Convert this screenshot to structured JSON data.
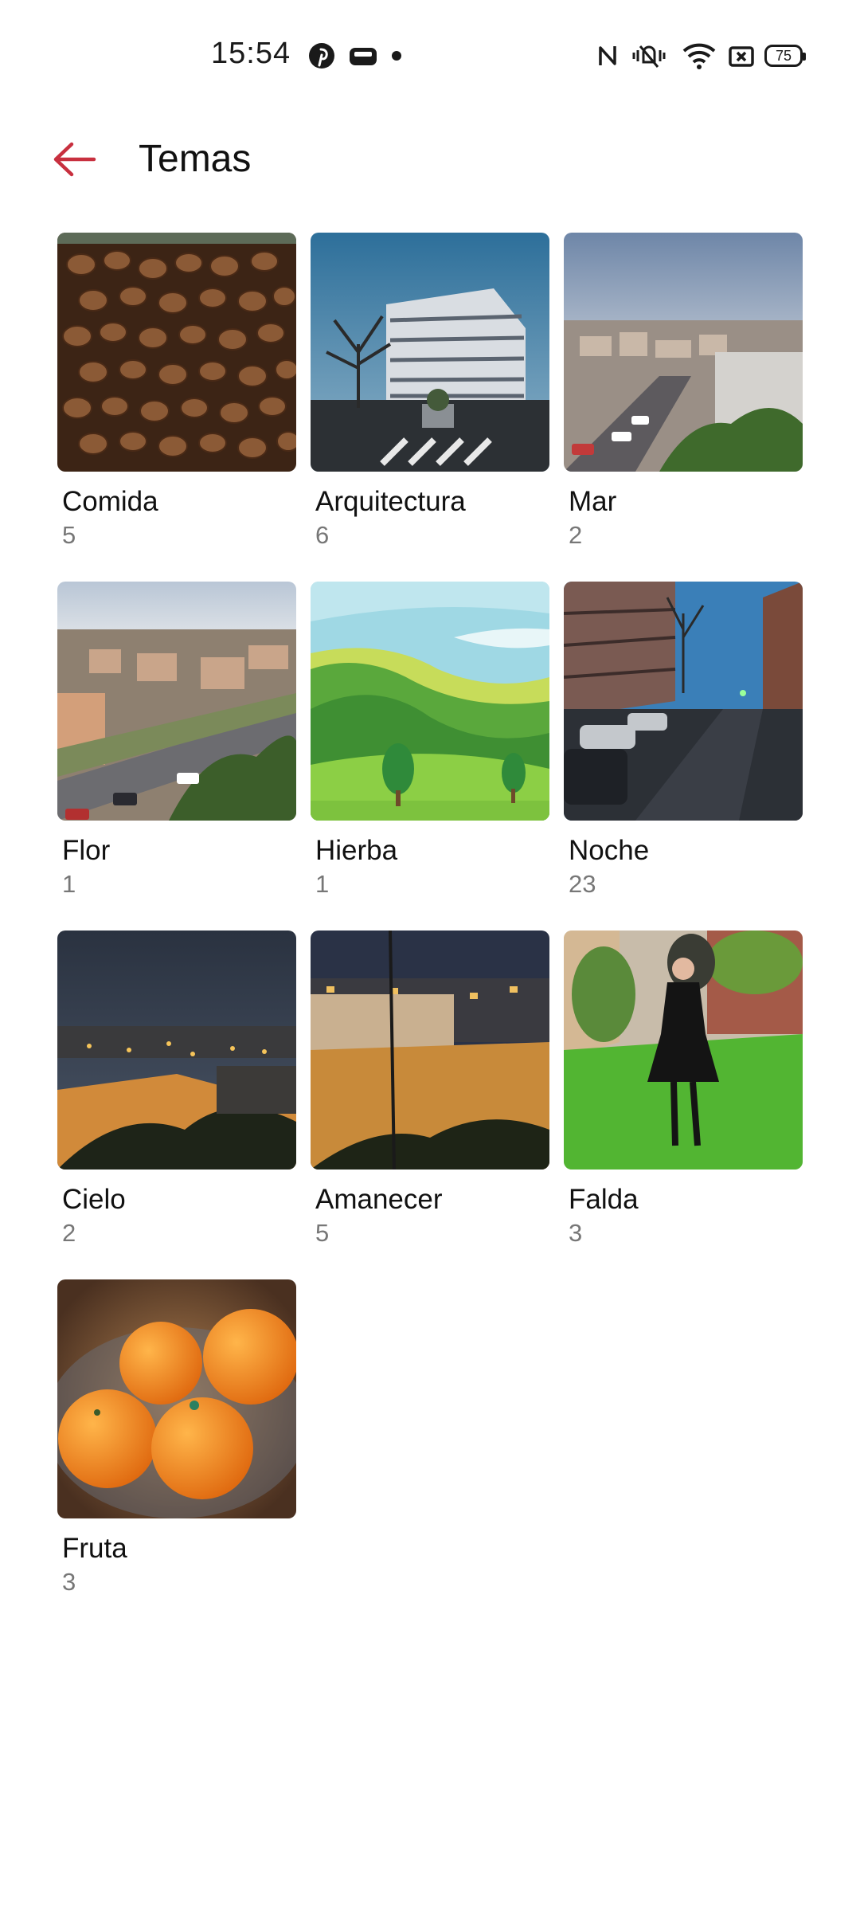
{
  "status_bar": {
    "time": "15:54",
    "battery": "75",
    "icons": [
      "pinterest-icon",
      "screen-record-icon",
      "notification-dot-icon",
      "nfc-icon",
      "vibrate-icon",
      "wifi-icon",
      "no-sim-icon",
      "battery-icon"
    ]
  },
  "header": {
    "title": "Temas",
    "back_icon": "back-arrow-icon",
    "accent_color": "#c8303f"
  },
  "albums": [
    {
      "name": "Comida",
      "count": "5"
    },
    {
      "name": "Arquitectura",
      "count": "6"
    },
    {
      "name": "Mar",
      "count": "2"
    },
    {
      "name": "Flor",
      "count": "1"
    },
    {
      "name": "Hierba",
      "count": "1"
    },
    {
      "name": "Noche",
      "count": "23"
    },
    {
      "name": "Cielo",
      "count": "2"
    },
    {
      "name": "Amanecer",
      "count": "5"
    },
    {
      "name": "Falda",
      "count": "3"
    },
    {
      "name": "Fruta",
      "count": "3"
    }
  ]
}
